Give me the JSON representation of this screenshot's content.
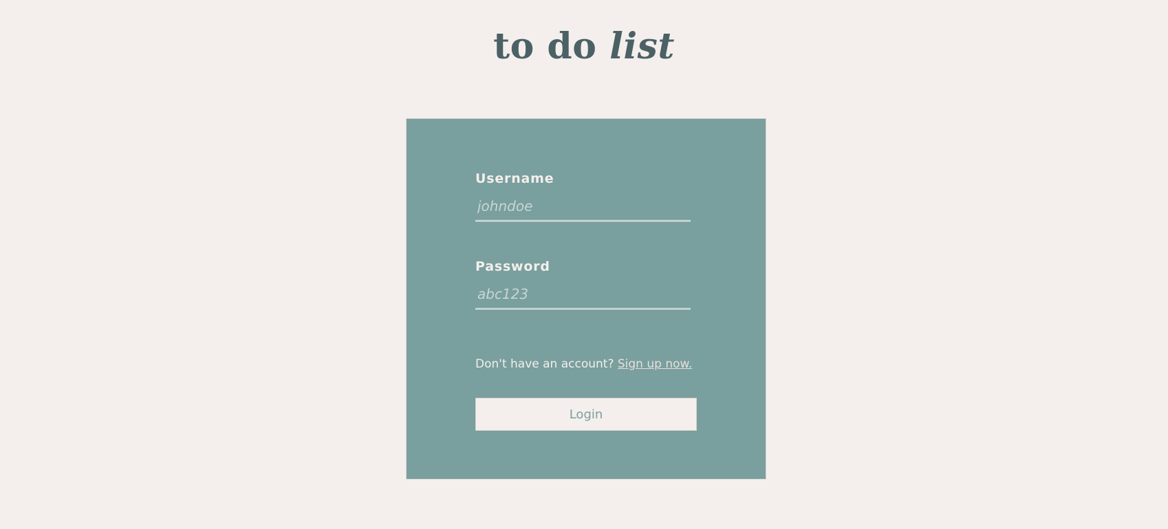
{
  "header": {
    "title_plain": "to do",
    "title_emphasis": "list"
  },
  "login_form": {
    "username": {
      "label": "Username",
      "placeholder": "johndoe",
      "value": ""
    },
    "password": {
      "label": "Password",
      "placeholder": "abc123",
      "value": ""
    },
    "signup_prompt": "Don't have an account?",
    "signup_link": "Sign up now.",
    "login_button": "Login"
  },
  "colors": {
    "page_background": "#f4efec",
    "card_background": "#799f9e",
    "title_text": "#4b6165",
    "light_text": "#f4efec"
  }
}
